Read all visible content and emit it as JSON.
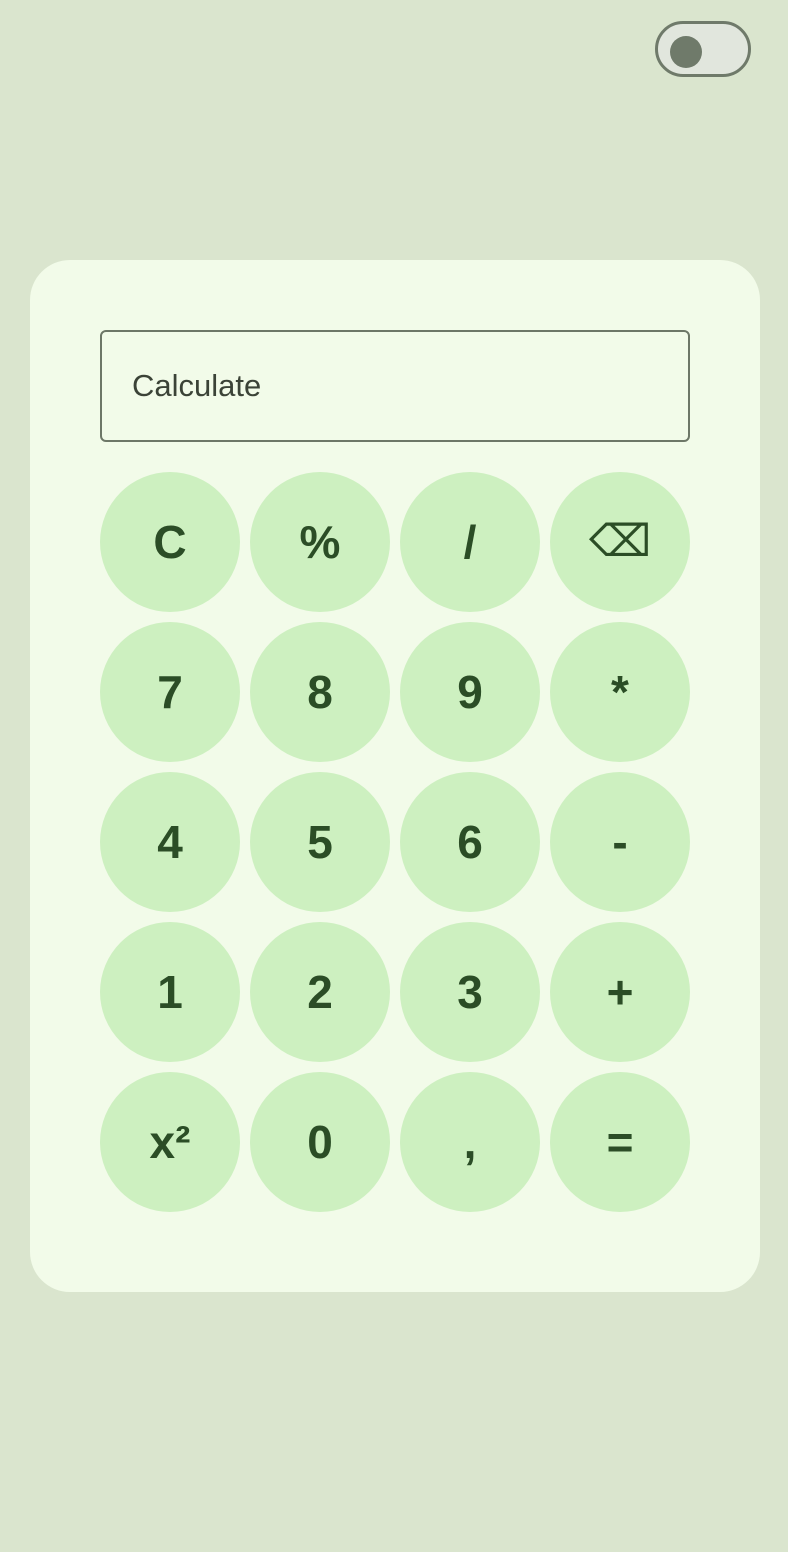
{
  "theme_toggle": {
    "state": "off",
    "track_color": "#e1e6dd",
    "thumb_color": "#6f7a6a"
  },
  "calculator": {
    "display": {
      "value": "",
      "placeholder": "Calculate"
    },
    "keys": [
      {
        "label": "C",
        "name": "clear-button"
      },
      {
        "label": "%",
        "name": "percent-button"
      },
      {
        "label": "/",
        "name": "divide-button"
      },
      {
        "label": "⌫",
        "name": "backspace-button",
        "icon": "backspace-icon"
      },
      {
        "label": "7",
        "name": "digit-7-button"
      },
      {
        "label": "8",
        "name": "digit-8-button"
      },
      {
        "label": "9",
        "name": "digit-9-button"
      },
      {
        "label": "*",
        "name": "multiply-button"
      },
      {
        "label": "4",
        "name": "digit-4-button"
      },
      {
        "label": "5",
        "name": "digit-5-button"
      },
      {
        "label": "6",
        "name": "digit-6-button"
      },
      {
        "label": "-",
        "name": "subtract-button"
      },
      {
        "label": "1",
        "name": "digit-1-button"
      },
      {
        "label": "2",
        "name": "digit-2-button"
      },
      {
        "label": "3",
        "name": "digit-3-button"
      },
      {
        "label": "+",
        "name": "add-button"
      },
      {
        "label": "x²",
        "name": "square-button"
      },
      {
        "label": "0",
        "name": "digit-0-button"
      },
      {
        "label": ",",
        "name": "decimal-comma-button"
      },
      {
        "label": "=",
        "name": "equals-button"
      }
    ]
  },
  "colors": {
    "background": "#dae5ce",
    "card": "#f2fbe9",
    "key": "#cdf0c0",
    "key_text": "#2b4d26",
    "display_border": "#6d7767"
  }
}
